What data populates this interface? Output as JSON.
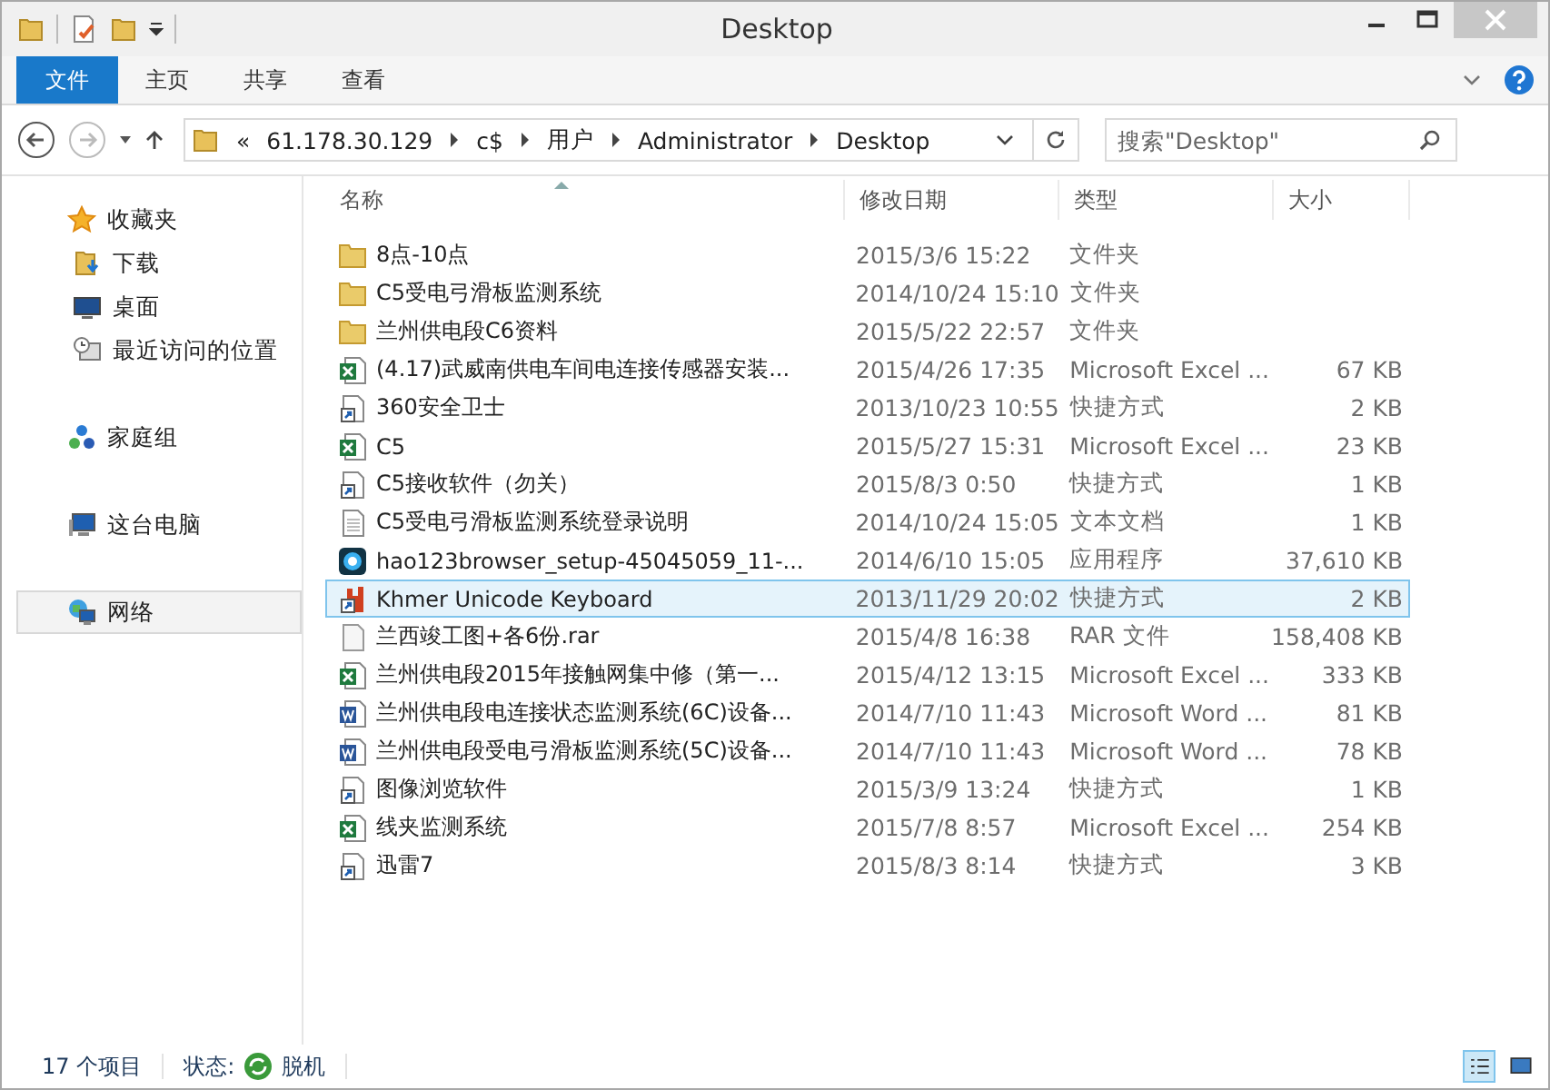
{
  "window": {
    "title": "Desktop"
  },
  "ribbon_tabs": [
    {
      "label": "文件",
      "kind": "file"
    },
    {
      "label": "主页",
      "kind": "tab"
    },
    {
      "label": "共享",
      "kind": "tab"
    },
    {
      "label": "查看",
      "kind": "tab"
    }
  ],
  "address_bar": {
    "breadcrumb": [
      "«",
      "61.178.30.129",
      "c$",
      "用户",
      "Administrator",
      "Desktop"
    ]
  },
  "search": {
    "placeholder": "搜索\"Desktop\""
  },
  "sidebar": {
    "items": [
      {
        "label": "收藏夹",
        "kind": "star",
        "selected": false,
        "children": [
          {
            "label": "下载",
            "kind": "download",
            "selected": false
          },
          {
            "label": "桌面",
            "kind": "desktop",
            "selected": false
          },
          {
            "label": "最近访问的位置",
            "kind": "recent",
            "selected": false
          }
        ]
      },
      {
        "label": "家庭组",
        "kind": "homegroup",
        "selected": false
      },
      {
        "label": "这台电脑",
        "kind": "computer",
        "selected": false
      },
      {
        "label": "网络",
        "kind": "network",
        "selected": true
      }
    ]
  },
  "table": {
    "columns": [
      {
        "label": "名称",
        "sorted": true
      },
      {
        "label": "修改日期",
        "sorted": false
      },
      {
        "label": "类型",
        "sorted": false
      },
      {
        "label": "大小",
        "sorted": false
      }
    ],
    "rows": [
      {
        "name": "8点-10点",
        "date": "2015/3/6 15:22",
        "type": "文件夹",
        "size": "",
        "kind": "folder",
        "selected": false
      },
      {
        "name": "C5受电弓滑板监测系统",
        "date": "2014/10/24 15:10",
        "type": "文件夹",
        "size": "",
        "kind": "folder",
        "selected": false
      },
      {
        "name": "兰州供电段C6资料",
        "date": "2015/5/22 22:57",
        "type": "文件夹",
        "size": "",
        "kind": "folder",
        "selected": false
      },
      {
        "name": "(4.17)武威南供电车间电连接传感器安装...",
        "date": "2015/4/26 17:35",
        "type": "Microsoft Excel ...",
        "size": "67 KB",
        "kind": "excel",
        "selected": false
      },
      {
        "name": "360安全卫士",
        "date": "2013/10/23 10:55",
        "type": "快捷方式",
        "size": "2 KB",
        "kind": "shortcut",
        "selected": false
      },
      {
        "name": "C5",
        "date": "2015/5/27 15:31",
        "type": "Microsoft Excel ...",
        "size": "23 KB",
        "kind": "excel",
        "selected": false
      },
      {
        "name": "C5接收软件（勿关）",
        "date": "2015/8/3 0:50",
        "type": "快捷方式",
        "size": "1 KB",
        "kind": "shortcut",
        "selected": false
      },
      {
        "name": "C5受电弓滑板监测系统登录说明",
        "date": "2014/10/24 15:05",
        "type": "文本文档",
        "size": "1 KB",
        "kind": "text",
        "selected": false
      },
      {
        "name": "hao123browser_setup-45045059_11-...",
        "date": "2014/6/10 15:05",
        "type": "应用程序",
        "size": "37,610 KB",
        "kind": "app",
        "selected": false
      },
      {
        "name": "Khmer Unicode Keyboard",
        "date": "2013/11/29 20:02",
        "type": "快捷方式",
        "size": "2 KB",
        "kind": "keyboard",
        "selected": true
      },
      {
        "name": "兰西竣工图+各6份.rar",
        "date": "2015/4/8 16:38",
        "type": "RAR 文件",
        "size": "158,408 KB",
        "kind": "file",
        "selected": false
      },
      {
        "name": "兰州供电段2015年接触网集中修（第一...",
        "date": "2015/4/12 13:15",
        "type": "Microsoft Excel ...",
        "size": "333 KB",
        "kind": "excel",
        "selected": false
      },
      {
        "name": "兰州供电段电连接状态监测系统(6C)设备...",
        "date": "2014/7/10 11:43",
        "type": "Microsoft Word ...",
        "size": "81 KB",
        "kind": "word",
        "selected": false
      },
      {
        "name": "兰州供电段受电弓滑板监测系统(5C)设备...",
        "date": "2014/7/10 11:43",
        "type": "Microsoft Word ...",
        "size": "78 KB",
        "kind": "word",
        "selected": false
      },
      {
        "name": "图像浏览软件",
        "date": "2015/3/9 13:24",
        "type": "快捷方式",
        "size": "1 KB",
        "kind": "shortcut",
        "selected": false
      },
      {
        "name": "线夹监测系统",
        "date": "2015/7/8 8:57",
        "type": "Microsoft Excel ...",
        "size": "254 KB",
        "kind": "excel",
        "selected": false
      },
      {
        "name": "迅雷7",
        "date": "2015/8/3 8:14",
        "type": "快捷方式",
        "size": "3 KB",
        "kind": "shortcut",
        "selected": false
      }
    ]
  },
  "status_bar": {
    "count": "17 个项目",
    "state_label": "状态:",
    "state": "脱机",
    "views": [
      {
        "selected": true
      },
      {
        "selected": false
      }
    ]
  }
}
